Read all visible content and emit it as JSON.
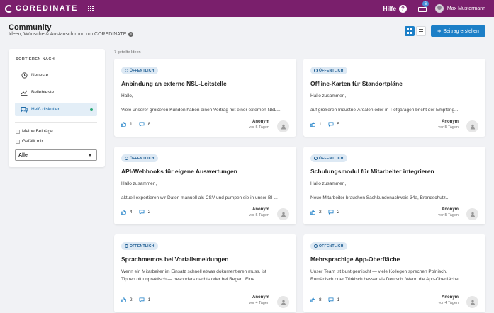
{
  "topbar": {
    "brand": "COREDINATE",
    "help_label": "Hilfe",
    "help_glyph": "?",
    "inbox_count": "6",
    "user_name": "Max Mustermann"
  },
  "header": {
    "title": "Community",
    "subtitle": "Ideen, Wünsche & Austausch rund um COREDINATE",
    "create_button": "Beitrag erstellen"
  },
  "sidebar": {
    "sort_title": "SORTIEREN NACH",
    "sort_items": [
      {
        "label": "Neueste",
        "icon": "clock-icon",
        "active": false
      },
      {
        "label": "Beliebteste",
        "icon": "trend-icon",
        "active": false
      },
      {
        "label": "Heiß diskutiert",
        "icon": "chat-icon",
        "active": true
      }
    ],
    "filters": [
      {
        "label": "Meine Beiträge",
        "checked": false
      },
      {
        "label": "Gefällt mir",
        "checked": false
      }
    ],
    "select_value": "Alle"
  },
  "main": {
    "count_label": "7 geteilte Ideen",
    "cards": [
      {
        "badge": "ÖFFENTLICH",
        "title": "Anbindung an externe NSL-Leitstelle",
        "text1": "Hallo,",
        "text2": "Viele unserer größeren Kunden haben einen Vertrag mit einer externen NSL...",
        "likes": "1",
        "comments": "8",
        "author": "Anonym",
        "date": "vor 5 Tagen"
      },
      {
        "badge": "ÖFFENTLICH",
        "title": "Offline-Karten für Standortpläne",
        "text1": "Hallo zusammen,",
        "text2": "auf größeren Industrie-Arealen oder in Tiefgaragen bricht der Empfang...",
        "likes": "1",
        "comments": "5",
        "author": "Anonym",
        "date": "vor 5 Tagen"
      },
      {
        "badge": "ÖFFENTLICH",
        "title": "API-Webhooks für eigene Auswertungen",
        "text1": "Hallo zusammen,",
        "text2": "aktuell exportieren wir Daten manuell als CSV und pumpen sie in unser BI-...",
        "likes": "4",
        "comments": "2",
        "author": "Anonym",
        "date": "vor 5 Tagen"
      },
      {
        "badge": "ÖFFENTLICH",
        "title": "Schulungsmodul für Mitarbeiter integrieren",
        "text1": "Hallo zusammen,",
        "text2": "Neue Mitarbeiter brauchen Sachkundenachweis 34a, Brandschutz...",
        "likes": "2",
        "comments": "2",
        "author": "Anonym",
        "date": "vor 5 Tagen"
      },
      {
        "badge": "ÖFFENTLICH",
        "title": "Sprachmemos bei Vorfallsmeldungen",
        "text1": "Wenn ein Mitarbeiter im Einsatz schnell etwas dokumentieren muss, ist",
        "text2": "Tippen oft unpraktisch — besonders nachts oder bei Regen. Eine...",
        "likes": "2",
        "comments": "1",
        "author": "Anonym",
        "date": "vor 4 Tagen"
      },
      {
        "badge": "ÖFFENTLICH",
        "title": "Mehrsprachige App-Oberfläche",
        "text1": "Unser Team ist bunt gemischt — viele Kollegen sprechen Polnisch,",
        "text2": "Rumänisch oder Türkisch besser als Deutsch. Wenn die App-Oberfläche...",
        "likes": "8",
        "comments": "1",
        "author": "Anonym",
        "date": "vor 4 Tagen"
      }
    ]
  },
  "colors": {
    "brand": "#7a1f6c",
    "accent": "#1c7fc7",
    "active_dot": "#2aa876"
  }
}
